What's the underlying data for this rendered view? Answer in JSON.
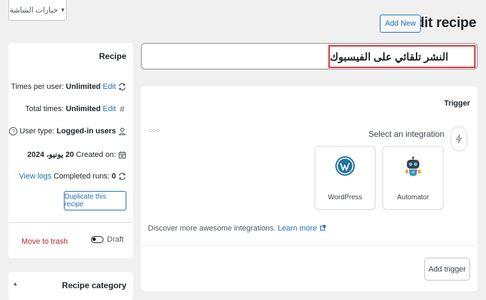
{
  "header": {
    "screen_options": "خيارات الشاشة",
    "title": "Edit recipe",
    "add_new": "Add New"
  },
  "recipe_title": {
    "value": "النشر تلقائي على الفيسبوك"
  },
  "sidebar": {
    "recipe_box": {
      "heading": "Recipe",
      "times_per_user": {
        "label": "Times per user:",
        "value": "Unlimited",
        "edit": "Edit"
      },
      "total_times": {
        "label": "Total times:",
        "value": "Unlimited",
        "edit": "Edit"
      },
      "user_type": {
        "label": "User type:",
        "value": "Logged-in users"
      },
      "created_on": {
        "label": "Created on:",
        "value": "20 يونيو، 2024"
      },
      "completed_runs": {
        "label": "Completed runs:",
        "value": "0",
        "link": "View logs"
      },
      "duplicate_button": "Duplicate this recipe",
      "move_to_trash": "Move to trash",
      "status": "Draft"
    },
    "category_box": {
      "heading": "Recipe category"
    }
  },
  "trigger": {
    "heading": "Trigger",
    "select_integration": "Select an integration",
    "integrations": [
      {
        "name": "WordPress",
        "icon": "wordpress-icon"
      },
      {
        "name": "Automator",
        "icon": "automator-icon"
      }
    ],
    "discover_text": "Discover more awesome integrations.",
    "learn_more": "Learn more",
    "add_trigger": "Add trigger"
  },
  "colors": {
    "accent": "#2271b1",
    "danger": "#b32d2e",
    "highlight_border": "#d63638"
  }
}
